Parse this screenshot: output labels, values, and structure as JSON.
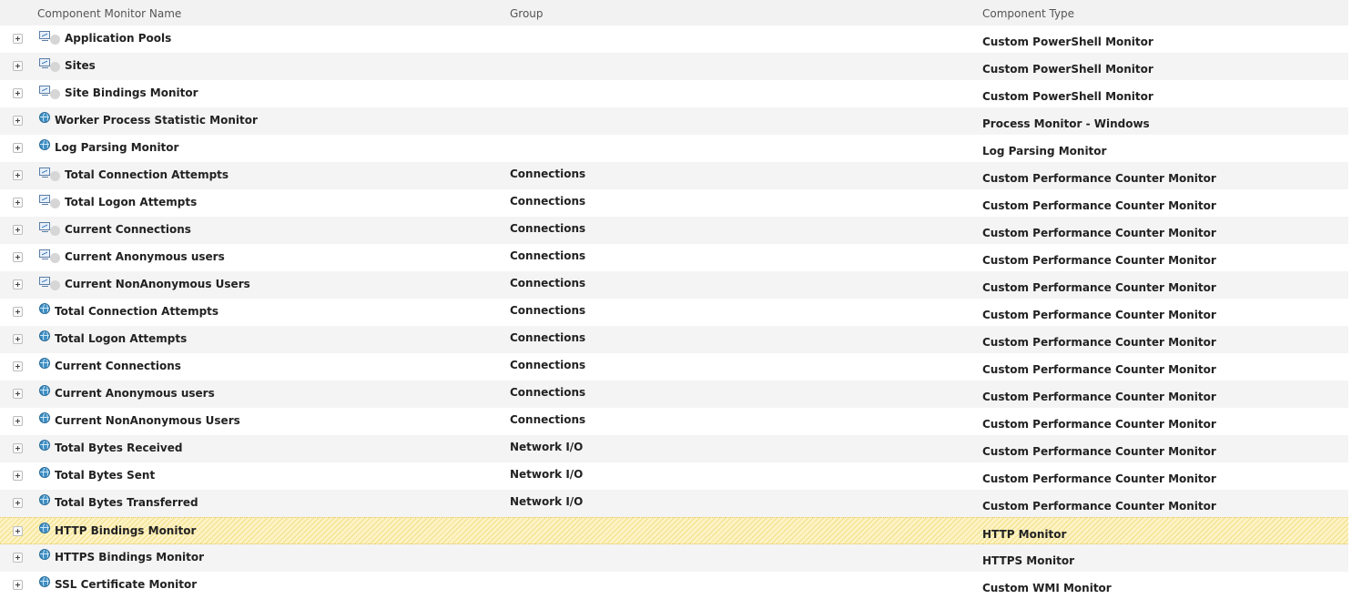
{
  "columns": {
    "name": "Component Monitor Name",
    "group": "Group",
    "type": "Component Type"
  },
  "rows": [
    {
      "icon": "monitor-status-icon",
      "name": "Application Pools",
      "group": "",
      "type": "Custom PowerShell Monitor"
    },
    {
      "icon": "monitor-status-icon",
      "name": "Sites",
      "group": "",
      "type": "Custom PowerShell Monitor"
    },
    {
      "icon": "monitor-status-icon",
      "name": "Site Bindings Monitor",
      "group": "",
      "type": "Custom PowerShell Monitor"
    },
    {
      "icon": "globe-icon",
      "name": "Worker Process Statistic Monitor",
      "group": "",
      "type": "Process Monitor - Windows"
    },
    {
      "icon": "globe-icon",
      "name": "Log Parsing Monitor",
      "group": "",
      "type": "Log Parsing Monitor"
    },
    {
      "icon": "monitor-status-icon",
      "name": "Total Connection Attempts",
      "group": "Connections",
      "type": "Custom Performance Counter Monitor"
    },
    {
      "icon": "monitor-status-icon",
      "name": "Total Logon Attempts",
      "group": "Connections",
      "type": "Custom Performance Counter Monitor"
    },
    {
      "icon": "monitor-status-icon",
      "name": "Current Connections",
      "group": "Connections",
      "type": "Custom Performance Counter Monitor"
    },
    {
      "icon": "monitor-status-icon",
      "name": "Current Anonymous users",
      "group": "Connections",
      "type": "Custom Performance Counter Monitor"
    },
    {
      "icon": "monitor-status-icon",
      "name": "Current NonAnonymous Users",
      "group": "Connections",
      "type": "Custom Performance Counter Monitor"
    },
    {
      "icon": "globe-icon",
      "name": "Total Connection Attempts",
      "group": "Connections",
      "type": "Custom Performance Counter Monitor"
    },
    {
      "icon": "globe-icon",
      "name": "Total Logon Attempts",
      "group": "Connections",
      "type": "Custom Performance Counter Monitor"
    },
    {
      "icon": "globe-icon",
      "name": "Current Connections",
      "group": "Connections",
      "type": "Custom Performance Counter Monitor"
    },
    {
      "icon": "globe-icon",
      "name": "Current Anonymous users",
      "group": "Connections",
      "type": "Custom Performance Counter Monitor"
    },
    {
      "icon": "globe-icon",
      "name": "Current NonAnonymous Users",
      "group": "Connections",
      "type": "Custom Performance Counter Monitor"
    },
    {
      "icon": "globe-icon",
      "name": "Total Bytes Received",
      "group": "Network I/O",
      "type": "Custom Performance Counter Monitor"
    },
    {
      "icon": "globe-icon",
      "name": "Total Bytes Sent",
      "group": "Network I/O",
      "type": "Custom Performance Counter Monitor"
    },
    {
      "icon": "globe-icon",
      "name": "Total Bytes Transferred",
      "group": "Network I/O",
      "type": "Custom Performance Counter Monitor"
    },
    {
      "icon": "globe-icon",
      "name": "HTTP Bindings Monitor",
      "group": "",
      "type": "HTTP Monitor",
      "highlighted": true
    },
    {
      "icon": "globe-icon",
      "name": "HTTPS Bindings Monitor",
      "group": "",
      "type": "HTTPS Monitor"
    },
    {
      "icon": "globe-icon",
      "name": "SSL Certificate Monitor",
      "group": "",
      "type": "Custom WMI Monitor"
    }
  ],
  "colors": {
    "header_bg": "#f2f2f2",
    "alt_row_bg": "#f4f4f4",
    "highlight_bg": "#fdf3c4",
    "globe": "#3d8fc4"
  }
}
